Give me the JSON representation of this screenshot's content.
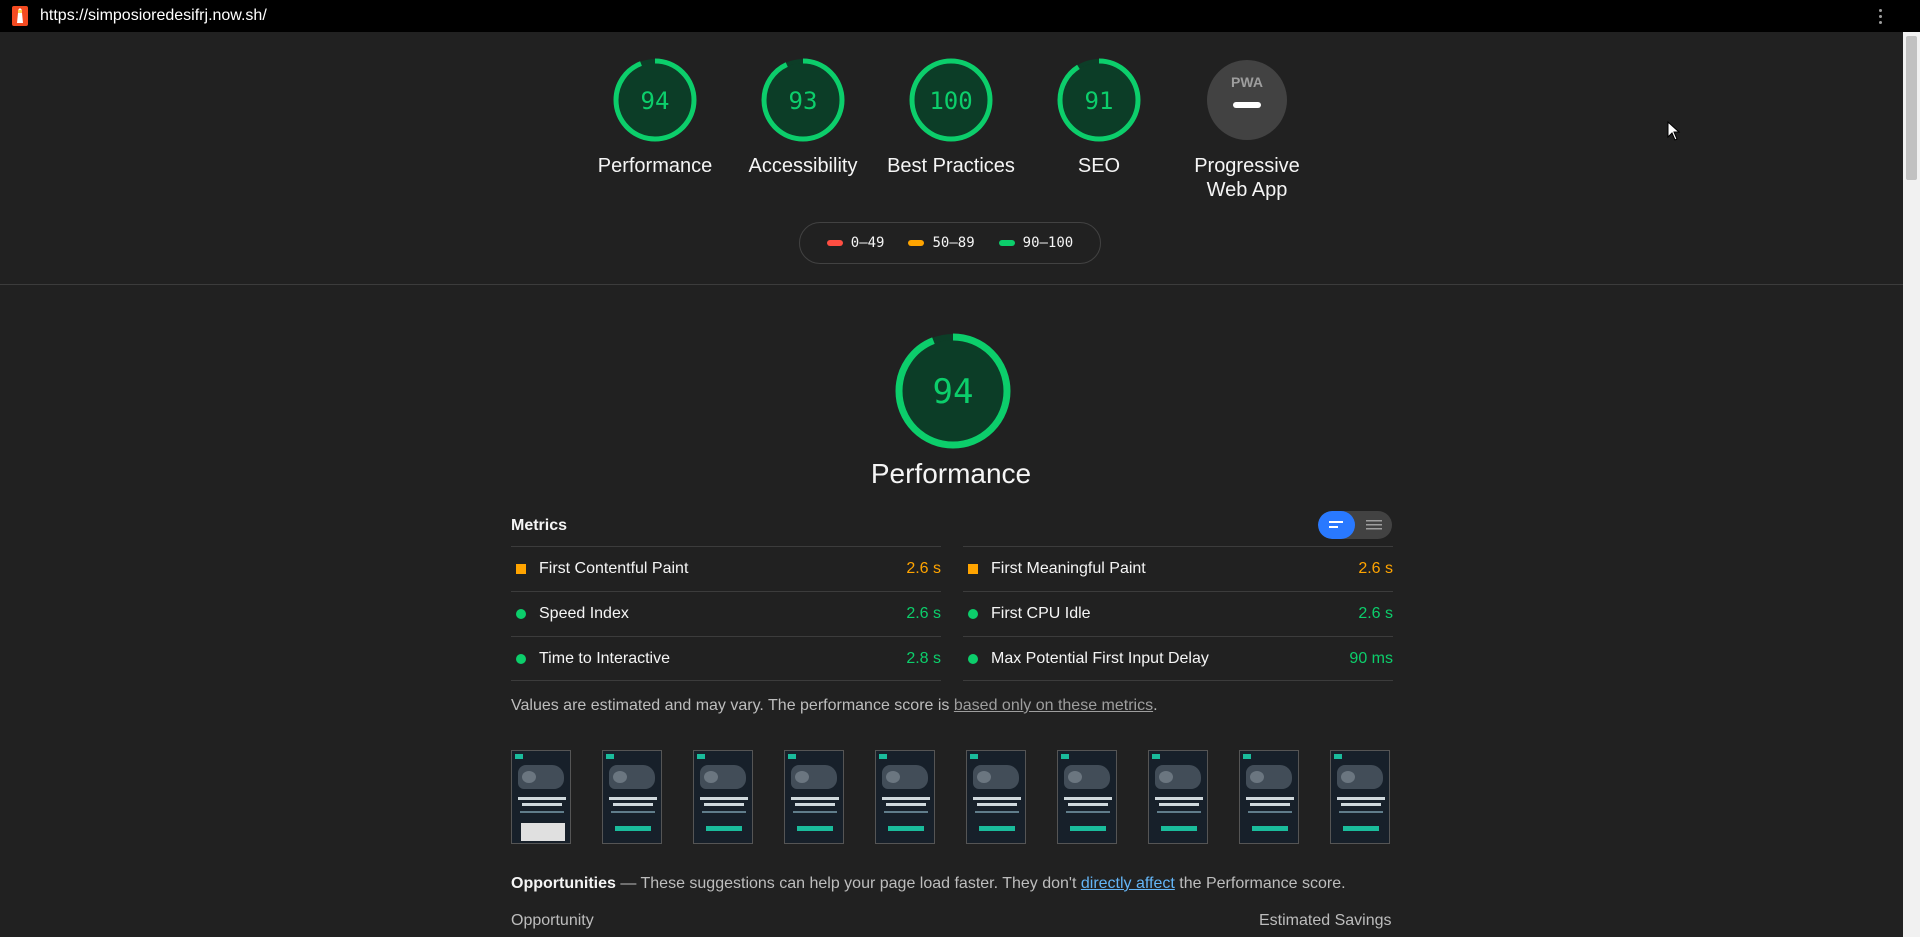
{
  "browser": {
    "url": "https://simposioredesifrj.now.sh/"
  },
  "colors": {
    "pass": "#0cce6b",
    "average": "#ffa400",
    "fail": "#ff4e42",
    "background": "#212121",
    "accent": "#2979ff"
  },
  "categories": [
    {
      "score": "94",
      "label": "Performance",
      "fraction": 0.94
    },
    {
      "score": "93",
      "label": "Accessibility",
      "fraction": 0.93
    },
    {
      "score": "100",
      "label": "Best Practices",
      "fraction": 1.0
    },
    {
      "score": "91",
      "label": "SEO",
      "fraction": 0.91
    },
    {
      "score": "PWA",
      "label_line1": "Progressive",
      "label_line2": "Web App"
    }
  ],
  "legend": [
    {
      "range": "0–49",
      "color": "#ff4e42"
    },
    {
      "range": "50–89",
      "color": "#ffa400"
    },
    {
      "range": "90–100",
      "color": "#0cce6b"
    }
  ],
  "performance": {
    "score": "94",
    "fraction": 0.94,
    "title": "Performance",
    "metrics_header": "Metrics",
    "metrics_left": [
      {
        "title": "First Contentful Paint",
        "value": "2.6 s",
        "rating": "average"
      },
      {
        "title": "Speed Index",
        "value": "2.6 s",
        "rating": "pass"
      },
      {
        "title": "Time to Interactive",
        "value": "2.8 s",
        "rating": "pass"
      }
    ],
    "metrics_right": [
      {
        "title": "First Meaningful Paint",
        "value": "2.6 s",
        "rating": "average"
      },
      {
        "title": "First CPU Idle",
        "value": "2.6 s",
        "rating": "pass"
      },
      {
        "title": "Max Potential First Input Delay",
        "value": "90 ms",
        "rating": "pass"
      }
    ],
    "note_prefix": "Values are estimated and may vary. The performance score is ",
    "note_link": "based only on these metrics",
    "note_suffix": ".",
    "filmstrip_frames": 10,
    "opportunities_title": "Opportunities",
    "opportunities_text": " — These suggestions can help your page load faster. They don't ",
    "opportunities_link": "directly affect",
    "opportunities_suffix": " the Performance score.",
    "col_opportunity": "Opportunity",
    "col_savings": "Estimated Savings"
  },
  "icons": {
    "logo": "lighthouse-icon",
    "menu": "kebab-menu-icon",
    "bar_view": "bar-view-icon",
    "list_view": "list-view-icon",
    "pwa": "pwa-badge-icon"
  }
}
